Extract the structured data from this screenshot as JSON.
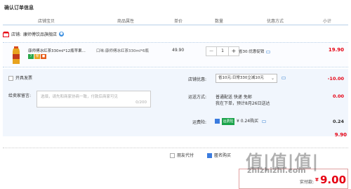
{
  "page": {
    "title": "确认订单信息"
  },
  "table_header": {
    "columns": [
      "店铺宝贝",
      "商品属性",
      "单价",
      "数量",
      "优惠方式",
      "小计"
    ]
  },
  "store": {
    "label": "店铺:",
    "name": "康师傅饮品旗舰店"
  },
  "item": {
    "name": "康师傅冰红茶330ml*12瓶苹果...",
    "badges": [
      "7",
      "保",
      "■"
    ],
    "attr_label": "口味:",
    "attr_value": "康师傅冰红茶330ml*6瓶",
    "price": "49.90",
    "quantity": "1",
    "qty_minus": "−",
    "qty_plus": "+",
    "promo": "省30:优惠促销",
    "subtotal": "19.90"
  },
  "options": {
    "invoice_label": "开具发票",
    "message_label": "给卖家留言:",
    "message_placeholder": "选填，请先和商家协商一致，付款后商家可见",
    "message_count": "0/200",
    "store_discount_label": "店铺优惠:",
    "store_discount_value": "省10元:日常330立减10元",
    "store_discount_amount": "-10.00",
    "shipping_label": "运送方式:",
    "shipping_value": "普通配送 快递 免邮",
    "shipping_note": "我在下单，预计8月26日送达",
    "shipping_amount": "0.00",
    "insurance_label": "运费险:",
    "insurance_badge": "运费险",
    "insurance_value": "¥ 0.24购买",
    "insurance_amount": "0.24"
  },
  "store_total": {
    "amount": "9.90"
  },
  "bottom": {
    "friend_pay_label": "朋友代付",
    "anonymous_label": "匿名购买"
  },
  "payment": {
    "label": "实付款:",
    "currency": "¥",
    "amount": "9.00"
  },
  "watermark": {
    "text": "值|值|值|",
    "url": "zhizhizhi.com"
  },
  "colors": {
    "accent_red": "#e60012",
    "accent_blue": "#3b7cdf",
    "option_bg": "#f1f6fd"
  }
}
